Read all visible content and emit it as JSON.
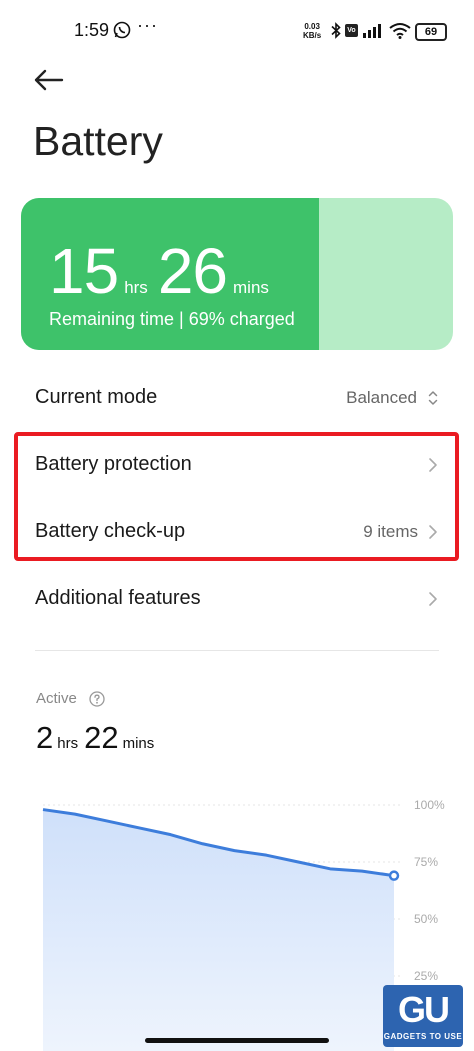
{
  "status_bar": {
    "time": "1:59",
    "more": "···",
    "net_speed_value": "0.03",
    "net_speed_unit": "KB/s",
    "volte": "Vo",
    "battery_level": "69"
  },
  "header": {
    "title": "Battery"
  },
  "battery_card": {
    "hours": "15",
    "hours_unit": "hrs",
    "minutes": "26",
    "minutes_unit": "mins",
    "subtitle": "Remaining time | 69% charged",
    "charge_fraction": 0.69,
    "fill_color": "#3ec26a",
    "track_color": "#b6ecc6"
  },
  "rows": {
    "current_mode": {
      "label": "Current mode",
      "value": "Balanced"
    },
    "battery_protection": {
      "label": "Battery protection"
    },
    "battery_checkup": {
      "label": "Battery check-up",
      "value": "9 items"
    },
    "additional_features": {
      "label": "Additional features"
    }
  },
  "highlight_color": "#ea1b22",
  "active": {
    "label": "Active",
    "hours": "2",
    "hours_unit": "hrs",
    "minutes": "22",
    "minutes_unit": "mins"
  },
  "chart_data": {
    "type": "area",
    "y_ticks": [
      "100%",
      "75%",
      "50%",
      "25%"
    ],
    "ylim": [
      0,
      100
    ],
    "x": [
      0,
      1,
      2,
      3,
      4,
      5,
      6,
      7,
      8,
      9,
      10,
      11
    ],
    "values": [
      98,
      96,
      93,
      90,
      87,
      83,
      80,
      78,
      75,
      72,
      71,
      69
    ],
    "line_color": "#3d7ddb"
  },
  "watermark": {
    "logo": "GU",
    "text": "GADGETS TO USE"
  }
}
